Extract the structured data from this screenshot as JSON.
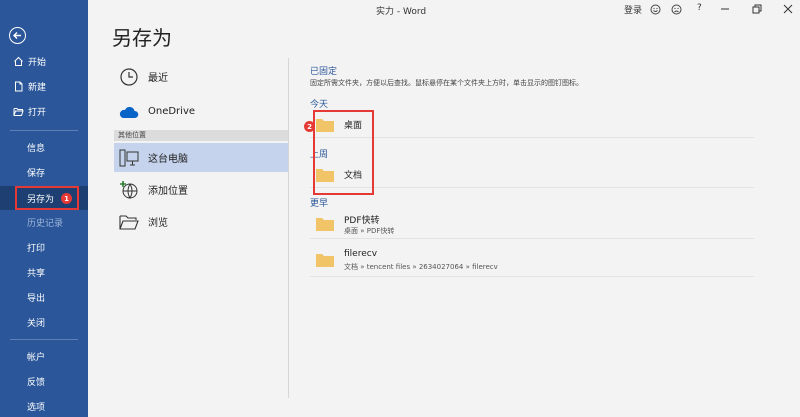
{
  "window": {
    "title": "实力 - Word",
    "signin_label": "登录",
    "help_label": "?"
  },
  "sidebar": {
    "items": [
      {
        "label": "开始",
        "icon": "home-icon"
      },
      {
        "label": "新建",
        "icon": "new-doc-icon"
      },
      {
        "label": "打开",
        "icon": "folder-open-icon"
      },
      {
        "label": "信息"
      },
      {
        "label": "保存"
      },
      {
        "label": "另存为",
        "active": true
      },
      {
        "label": "历史记录",
        "disabled": true
      },
      {
        "label": "打印"
      },
      {
        "label": "共享"
      },
      {
        "label": "导出"
      },
      {
        "label": "关闭"
      },
      {
        "label": "帐户"
      },
      {
        "label": "反馈"
      },
      {
        "label": "选项"
      }
    ],
    "badge": "1"
  },
  "page": {
    "title": "另存为"
  },
  "locations": {
    "recent": "最近",
    "onedrive": "OneDrive",
    "other_section": "其他位置",
    "this_pc": "这台电脑",
    "add_place": "添加位置",
    "browse": "浏览"
  },
  "right": {
    "pinned_head": "已固定",
    "pinned_desc": "固定所需文件夹，方便以后查找。鼠标悬停在某个文件夹上方时，单击显示的图钉图标。",
    "today_head": "今天",
    "lastweek_head": "上周",
    "earlier_head": "更早",
    "folders": {
      "desktop": "桌面",
      "documents": "文档",
      "pdf_name": "PDF快转",
      "pdf_path": "桌面 » PDF快转",
      "filerecv_name": "filerecv",
      "filerecv_path": "文档 » tencent files » 2634027064 » filerecv"
    },
    "badge": "2"
  },
  "colors": {
    "sidebar": "#2b579a",
    "accent": "#2b579a",
    "highlight": "#e53935",
    "folder": "#f0c467"
  }
}
